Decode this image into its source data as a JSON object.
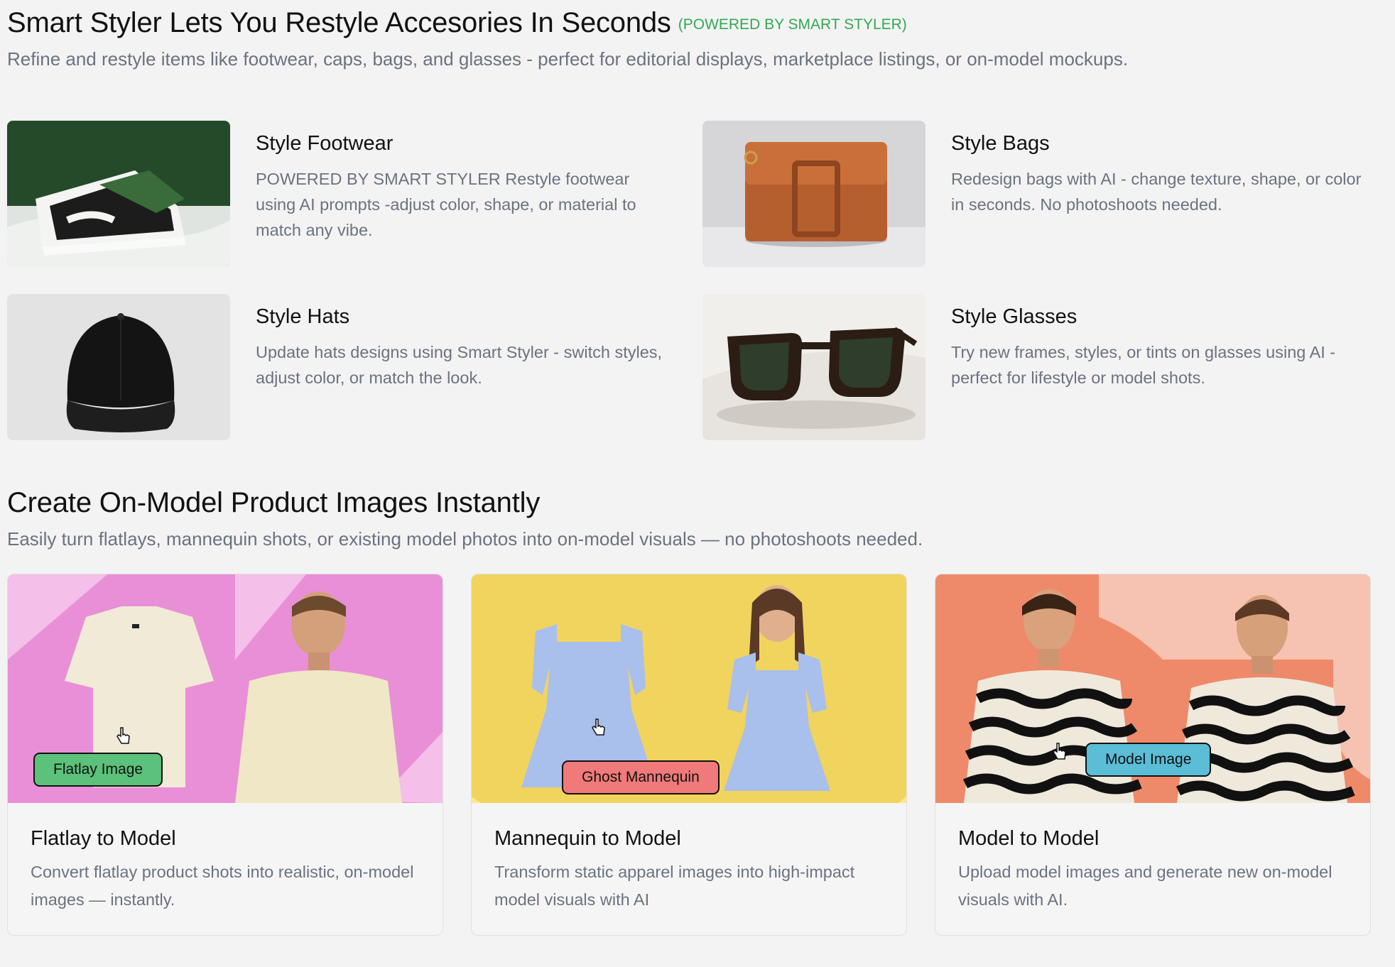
{
  "accessories": {
    "title": "Smart Styler Lets You Restyle Accesories In Seconds",
    "powered_tag": "(POWERED BY SMART STYLER)",
    "subtitle": "Refine and restyle items like footwear, caps, bags, and glasses - perfect for editorial displays, marketplace listings, or on-model mockups.",
    "items": [
      {
        "title": "Style Footwear",
        "description": "POWERED BY SMART STYLER Restyle footwear using AI prompts -adjust color, shape, or material to match any vibe."
      },
      {
        "title": "Style Bags",
        "description": "Redesign bags with AI - change texture, shape, or color in seconds. No photoshoots needed."
      },
      {
        "title": "Style Hats",
        "description": "Update hats designs using Smart Styler - switch styles, adjust color, or match the look."
      },
      {
        "title": "Style Glasses",
        "description": "Try new frames, styles, or tints on glasses using AI - perfect for lifestyle or model shots."
      }
    ]
  },
  "on_model": {
    "title": "Create On-Model Product Images Instantly",
    "subtitle": "Easily turn flatlays, mannequin shots, or existing model photos into on-model visuals — no photoshoots needed.",
    "cards": [
      {
        "badge": "Flatlay Image",
        "badge_color": "#5cc17a",
        "title": "Flatlay to Model",
        "description": "Convert flatlay product shots into realistic, on-model images — instantly."
      },
      {
        "badge": "Ghost Mannequin",
        "badge_color": "#f07a7a",
        "title": "Mannequin to Model",
        "description": "Transform static apparel images into high-impact model visuals with AI"
      },
      {
        "badge": "Model Image",
        "badge_color": "#5bbdd6",
        "title": "Model to Model",
        "description": "Upload model images and generate new on-model visuals with AI."
      }
    ]
  },
  "colors": {
    "accent_green": "#34a853",
    "muted_text": "#6b7280",
    "page_bg": "#f3f3f3"
  }
}
